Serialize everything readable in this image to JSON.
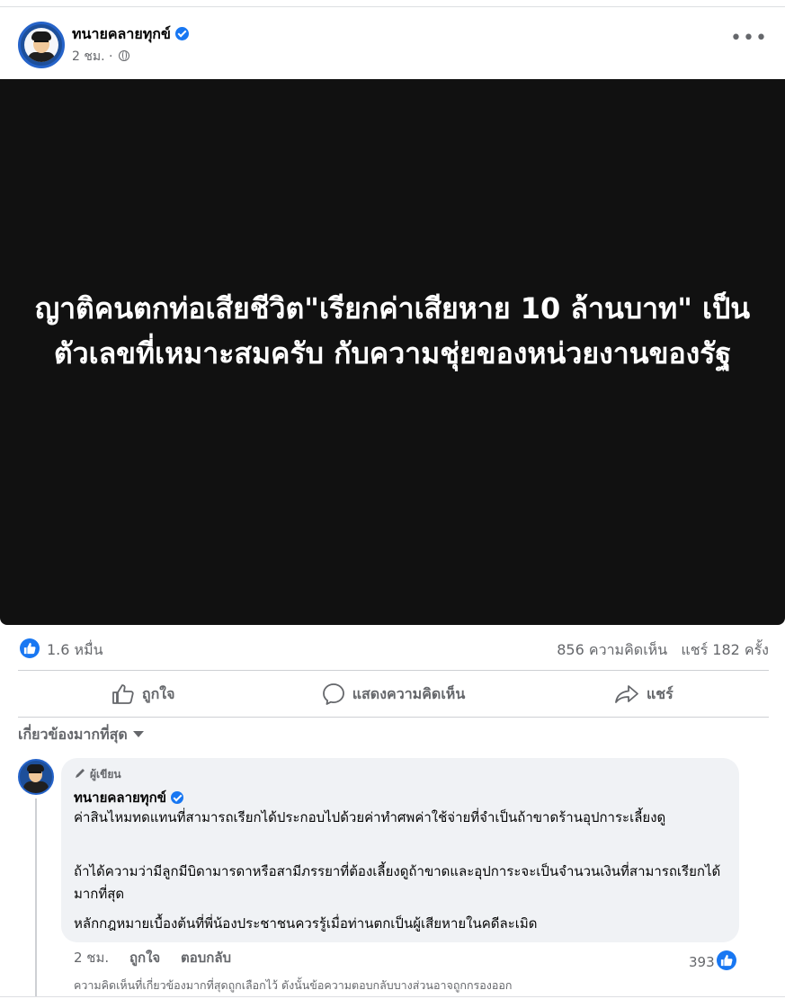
{
  "post": {
    "author": "ทนายคลายทุกข์",
    "time": "2 ชม. ·",
    "more_label": "•••",
    "image_text": "ญาติคนตกท่อเสียชีวิต\"เรียกค่าเสียหาย 10 ล้านบาท\" เป็นตัวเลขที่เหมาะสมครับ กับความชุ่ยของหน่วยงานของรัฐ"
  },
  "summary": {
    "reactions": "1.6 หมื่น",
    "comments": "856 ความคิดเห็น",
    "shares": "แชร์ 182 ครั้ง"
  },
  "actions": {
    "like": "ถูกใจ",
    "comment": "แสดงความคิดเห็น",
    "share": "แชร์"
  },
  "sort": {
    "label": "เกี่ยวข้องมากที่สุด"
  },
  "comment": {
    "badge": "ผู้เขียน",
    "author": "ทนายคลายทุกข์",
    "paragraphs": [
      "ค่าสินไหมทดแทนที่สามารถเรียกได้ประกอบไปด้วยค่าทำศพค่าใช้จ่ายที่จำเป็นถ้าขาดร้านอุปการะเลี้ยงดู",
      "ถ้าได้ความว่ามีลูกมีบิดามารดาหรือสามีภรรยาที่ต้องเลี้ยงดูถ้าขาดและอุปการะจะเป็นจำนวนเงินที่สามารถเรียกได้มากที่สุด",
      "หลักกฎหมายเบื้องต้นที่พี่น้องประชาชนควรรู้เมื่อท่านตกเป็นผู้เสียหายในคดีละเมิด"
    ],
    "time": "2 ชม.",
    "like": "ถูกใจ",
    "reply": "ตอบกลับ",
    "reactions": "393"
  },
  "note": "ความคิดเห็นที่เกี่ยวข้องมากที่สุดถูกเลือกไว้ ดังนั้นข้อความตอบกลับบางส่วนอาจถูกกรองออก",
  "colors": {
    "accent": "#1877f2",
    "image_bg": "#111111",
    "bubble": "#f0f2f5",
    "secondary_text": "#65676b"
  }
}
